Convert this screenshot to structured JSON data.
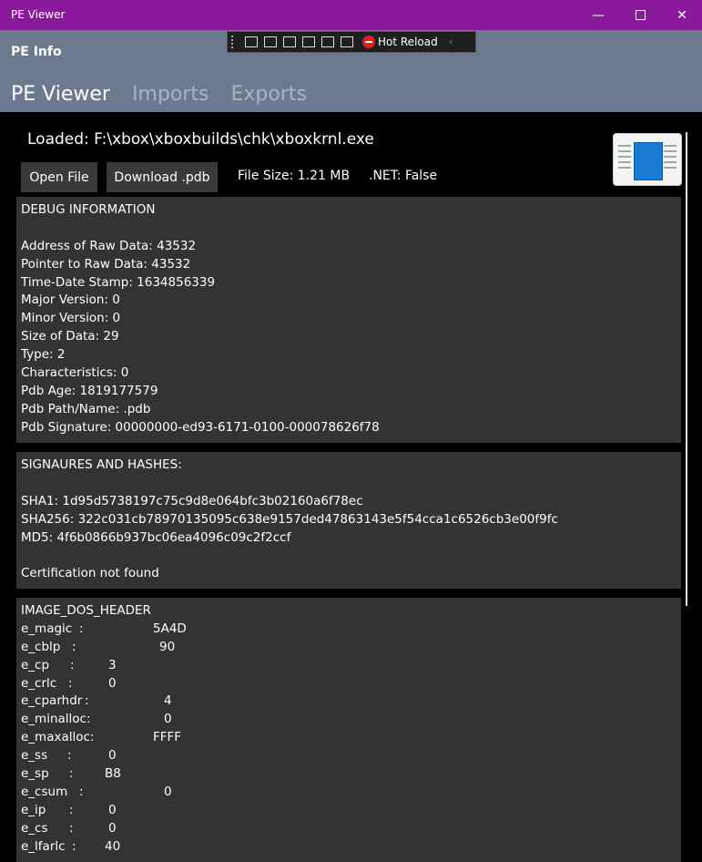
{
  "window": {
    "title": "PE Viewer"
  },
  "header": {
    "section_title": "PE Info",
    "tabs": [
      "PE Viewer",
      "Imports",
      "Exports"
    ]
  },
  "debug_toolbar": {
    "hot_reload_label": "Hot Reload"
  },
  "file": {
    "loaded_label": "Loaded: F:\\xbox\\xboxbuilds\\chk\\xboxkrnl.exe",
    "size_label": "File Size: 1.21 MB",
    "net_label": ".NET: False"
  },
  "buttons": {
    "open": "Open File",
    "download": "Download .pdb"
  },
  "debug_panel": {
    "lines": [
      "DEBUG INFORMATION",
      "",
      "Address of Raw Data: 43532",
      "Pointer to Raw Data: 43532",
      "Time-Date Stamp: 1634856339",
      "Major Version: 0",
      "Minor Version: 0",
      "Size of Data: 29",
      "Type: 2",
      "Characteristics: 0",
      "Pdb Age: 1819177579",
      "Pdb Path/Name: .pdb",
      "Pdb Signature: 00000000-ed93-6171-0100-000078626f78"
    ]
  },
  "sig_panel": {
    "lines": [
      "SIGNAURES AND HASHES:",
      "",
      "SHA1: 1d95d5738197c75c9d8e064bfc3b02160a6f78ec",
      "SHA256: 322c031cb78970135095c638e9157ded47863143e5f54cca1c6526cb3e00f9fc",
      "MD5: 4f6b0866b937bc06ea4096c09c2f2ccf",
      "",
      "Certification not found"
    ]
  },
  "dos_header": {
    "title": "IMAGE_DOS_HEADER",
    "fields": [
      {
        "name": "e_magic",
        "value": "5A4D"
      },
      {
        "name": "e_cblp",
        "value": "90"
      },
      {
        "name": "e_cp",
        "value": "3"
      },
      {
        "name": "e_crlc",
        "value": "0"
      },
      {
        "name": "e_cparhdr",
        "value": "4"
      },
      {
        "name": "e_minalloc",
        "value": "0"
      },
      {
        "name": "e_maxalloc",
        "value": "FFFF"
      },
      {
        "name": "e_ss",
        "value": "0"
      },
      {
        "name": "e_sp",
        "value": "B8"
      },
      {
        "name": "e_csum",
        "value": "0"
      },
      {
        "name": "e_ip",
        "value": "0"
      },
      {
        "name": "e_cs",
        "value": "0"
      },
      {
        "name": "e_lfarlc",
        "value": "40"
      }
    ]
  }
}
